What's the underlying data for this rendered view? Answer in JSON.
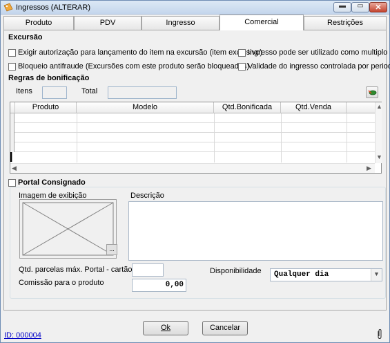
{
  "window": {
    "title": "Ingressos (ALTERAR)"
  },
  "titlebar_buttons": {
    "minimize": "▬",
    "maximize": "▭",
    "close": "✕"
  },
  "tabs": [
    {
      "label": "Produto",
      "active": false
    },
    {
      "label": "PDV",
      "active": false
    },
    {
      "label": "Ingresso",
      "active": false
    },
    {
      "label": "Comercial",
      "active": true
    },
    {
      "label": "Restrições",
      "active": false
    }
  ],
  "excursao": {
    "title": "Excursão",
    "options": [
      {
        "label": "Exigir autorização para lançamento do item  na excursão (item exclusivo)",
        "checked": false
      },
      {
        "label": "Ingresso pode ser utilizado como multiplo",
        "checked": false
      },
      {
        "label": "Bloqueio antifraude (Excursões com este produto serão bloqueadas)",
        "checked": false
      },
      {
        "label": "Validade do ingresso controlada por periodo",
        "checked": false
      }
    ]
  },
  "bonificacao": {
    "title": "Regras de bonificação",
    "itens_label": "Itens",
    "itens_value": "",
    "total_label": "Total",
    "total_value": "",
    "columns": [
      "Produto",
      "Modelo",
      "Qtd.Bonificada",
      "Qtd.Venda"
    ],
    "rows": []
  },
  "portal": {
    "checkbox_label": "Portal Consignado",
    "checked": false,
    "imagem_label": "Imagem de exibição",
    "image_button": "...",
    "descricao_label": "Descrição",
    "descricao_value": "",
    "parcelas_label": "Qtd. parcelas máx. Portal - cartão",
    "parcelas_value": "",
    "comissao_label": "Comissão para o produto",
    "comissao_value": "0,00",
    "disponibilidade_label": "Disponibilidade",
    "disponibilidade_value": "Qualquer dia"
  },
  "footer": {
    "ok_label": "Ok",
    "cancel_label": "Cancelar",
    "id_link": "ID: 000004"
  },
  "colors": {
    "accent": "#0000c8",
    "window_bg": "#f0f0f0",
    "titlebar": "#c4d6ec"
  }
}
